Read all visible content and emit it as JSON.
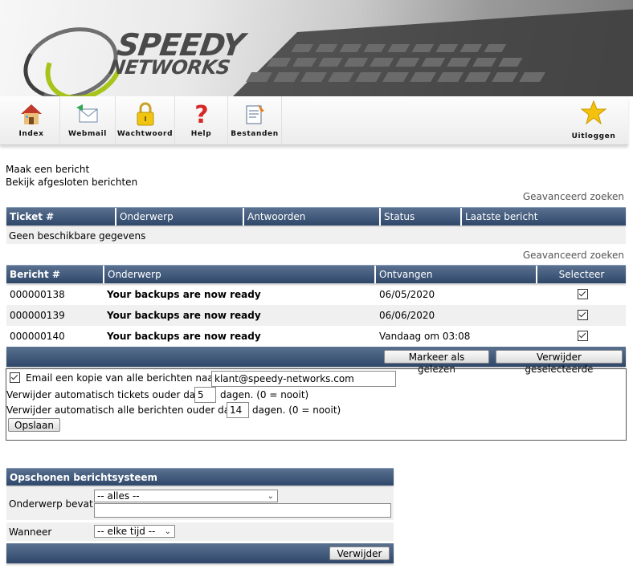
{
  "brand": {
    "line1": "SPEEDY",
    "line2": "NETWORKS"
  },
  "toolbar": {
    "items": [
      {
        "label": "Index",
        "icon": "house-icon"
      },
      {
        "label": "Webmail",
        "icon": "mail-icon"
      },
      {
        "label": "Wachtwoord",
        "icon": "lock-icon"
      },
      {
        "label": "Help",
        "icon": "question-icon"
      },
      {
        "label": "Bestanden",
        "icon": "files-icon"
      }
    ],
    "logout": {
      "label": "Uitloggen",
      "icon": "star-icon"
    }
  },
  "links": {
    "new_message": "Maak een bericht",
    "closed_messages": "Bekijk afgesloten berichten"
  },
  "advanced_search": "Geavanceerd zoeken",
  "tickets": {
    "headers": [
      "Ticket #",
      "Onderwerp",
      "Antwoorden",
      "Status",
      "Laatste bericht"
    ],
    "empty": "Geen beschikbare gegevens"
  },
  "messages": {
    "headers": [
      "Bericht #",
      "Onderwerp",
      "Ontvangen",
      "Selecteer"
    ],
    "rows": [
      {
        "id": "000000138",
        "subject": "Your backups are now ready",
        "received": "06/05/2020",
        "checked": true
      },
      {
        "id": "000000139",
        "subject": "Your backups are now ready",
        "received": "06/06/2020",
        "checked": true
      },
      {
        "id": "000000140",
        "subject": "Your backups are now ready",
        "received": "Vandaag om 03:08",
        "checked": true
      }
    ],
    "mark_read": "Markeer als gelezen",
    "delete_selected": "Verwijder geselecteerde"
  },
  "settings": {
    "email_copy_label": "Email een kopie van alle berichten naar",
    "email_copy_checked": true,
    "email": "klant@speedy-networks.com",
    "tickets_prefix": "Verwijder automatisch tickets ouder dan",
    "tickets_days": "5",
    "tickets_suffix": "dagen. (0 = nooit)",
    "messages_prefix": "Verwijder automatisch alle berichten ouder dan",
    "messages_days": "14",
    "messages_suffix": "dagen. (0 = nooit)",
    "save": "Opslaan"
  },
  "cleanup": {
    "title": "Opschonen berichtsysteem",
    "subject_label": "Onderwerp bevat",
    "subject_select": "-- alles --",
    "subject_text": "",
    "when_label": "Wanneer",
    "when_select": "-- elke tijd --",
    "delete": "Verwijder"
  },
  "colors": {
    "header_bar": "#3c5477",
    "logo_green": "#a6c41a",
    "row_alt": "#f0f0f0"
  }
}
